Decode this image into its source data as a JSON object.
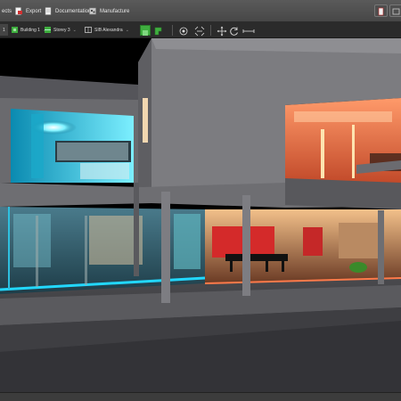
{
  "menubar": {
    "items": [
      {
        "label": "ects",
        "icon": "project-icon"
      },
      {
        "label": "Export",
        "icon": "export-icon"
      },
      {
        "label": "Documentation",
        "icon": "documentation-icon"
      },
      {
        "label": "Manufacture",
        "icon": "manufacture-icon"
      }
    ]
  },
  "breadcrumb": {
    "items": [
      {
        "label": "1"
      },
      {
        "label": "Building 1"
      },
      {
        "label": "Storey 3"
      },
      {
        "label": "SIB Alexandra"
      }
    ]
  },
  "colors": {
    "accent_green": "#3fae3f",
    "cyan_light": "#22d8ff",
    "warm_light": "#ff5a3a"
  },
  "viewport": {
    "scene": "3D rendering of a modern two-storey house at night with cyan and red interior lighting"
  }
}
